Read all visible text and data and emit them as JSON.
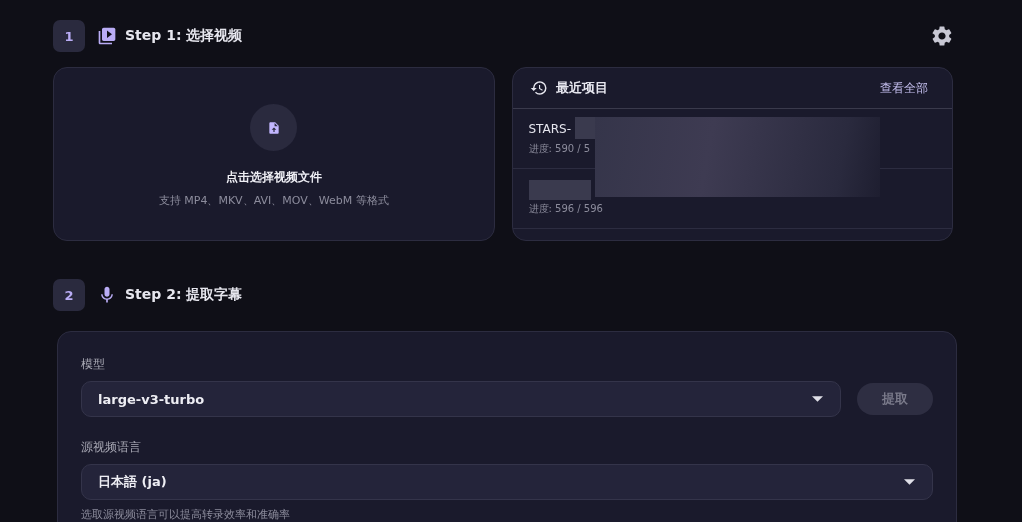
{
  "step1": {
    "number": "1",
    "title": "Step 1: 选择视频"
  },
  "upload": {
    "title": "点击选择视频文件",
    "hint": "支持 MP4、MKV、AVI、MOV、WebM 等格式"
  },
  "recent": {
    "title": "最近项目",
    "view_all": "查看全部",
    "items": [
      {
        "name": "STARS-",
        "progress": "进度: 590 / 5"
      },
      {
        "progress": "进度: 596 / 596"
      }
    ]
  },
  "step2": {
    "number": "2",
    "title": "Step 2: 提取字幕"
  },
  "form": {
    "model_label": "模型",
    "model_value": "large-v3-turbo",
    "extract_button": {
      "label": "提取",
      "disabled": true
    },
    "language_label": "源视频语言",
    "language_value": "日本語 (ja)",
    "language_hint": "选取源视频语言可以提高转录效率和准确率"
  }
}
